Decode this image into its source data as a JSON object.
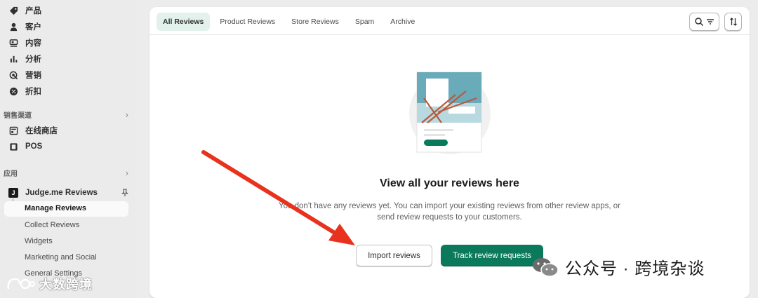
{
  "sidebar": {
    "main_items": [
      {
        "label": "产品",
        "icon": "tag-icon"
      },
      {
        "label": "客户",
        "icon": "person-icon"
      },
      {
        "label": "内容",
        "icon": "content-icon"
      },
      {
        "label": "分析",
        "icon": "bar-chart-icon"
      },
      {
        "label": "营销",
        "icon": "target-icon"
      },
      {
        "label": "折扣",
        "icon": "discount-icon"
      }
    ],
    "sales_channels": {
      "title": "销售渠道",
      "items": [
        {
          "label": "在线商店",
          "icon": "store-icon"
        },
        {
          "label": "POS",
          "icon": "pos-icon"
        }
      ]
    },
    "apps": {
      "title": "应用",
      "app_name": "Judge.me Reviews",
      "app_logo": "J",
      "sub_items": [
        "Manage Reviews",
        "Collect Reviews",
        "Widgets",
        "Marketing and Social",
        "General Settings"
      ]
    }
  },
  "tabs": [
    "All Reviews",
    "Product Reviews",
    "Store Reviews",
    "Spam",
    "Archive"
  ],
  "empty_state": {
    "title": "View all your reviews here",
    "description": "You don't have any reviews yet. You can import your existing reviews from other review apps, or send review requests to your customers.",
    "import_label": "Import reviews",
    "track_label": "Track review requests"
  },
  "watermarks": {
    "left": "大数跨境",
    "right": "公众号 · 跨境杂谈"
  },
  "colors": {
    "primary": "#0b7a5c",
    "tab_active_bg": "#e3f1ec",
    "arrow": "#e8321e"
  }
}
